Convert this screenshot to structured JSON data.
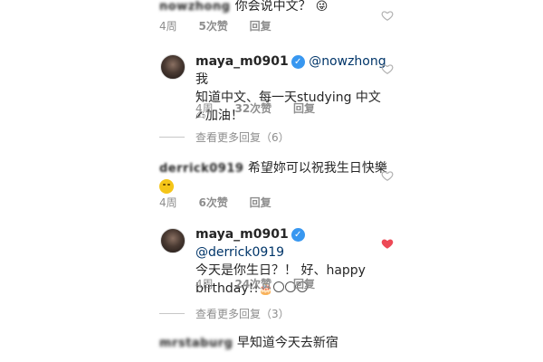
{
  "thread": {
    "comment1": {
      "text": "你会说中文？",
      "emoji": "😜",
      "time": "4周",
      "likes": "5次赞",
      "reply": "回复"
    },
    "reply1": {
      "username": "maya_m0901",
      "mention": "@nowzhong",
      "line1_tail": " 我",
      "line2": "知道中文、每一天studying 中文",
      "line3_emoji": "✍",
      "line3": "加油！",
      "time": "4周",
      "likes": "32次赞",
      "reply": "回复"
    },
    "view_more1": "查看更多回复（6）",
    "comment2": {
      "username": "derrick0919",
      "text": "希望妳可以祝我生日快樂",
      "time": "4周",
      "likes": "6次赞",
      "reply": "回复"
    },
    "reply2": {
      "username": "maya_m0901",
      "mention": "@derrick0919",
      "line2": "今天是你生日？！ 好、happy",
      "line3": "birthday!!",
      "line3_emoji": "🎂",
      "time": "4周",
      "likes": "24次赞",
      "reply": "回复"
    },
    "view_more2": "查看更多回复（3）",
    "comment3": {
      "text": "早知道今天去新宿"
    }
  },
  "colors": {
    "heart_liked": "#ed4956",
    "verified": "#3897f0",
    "link": "#003569"
  }
}
